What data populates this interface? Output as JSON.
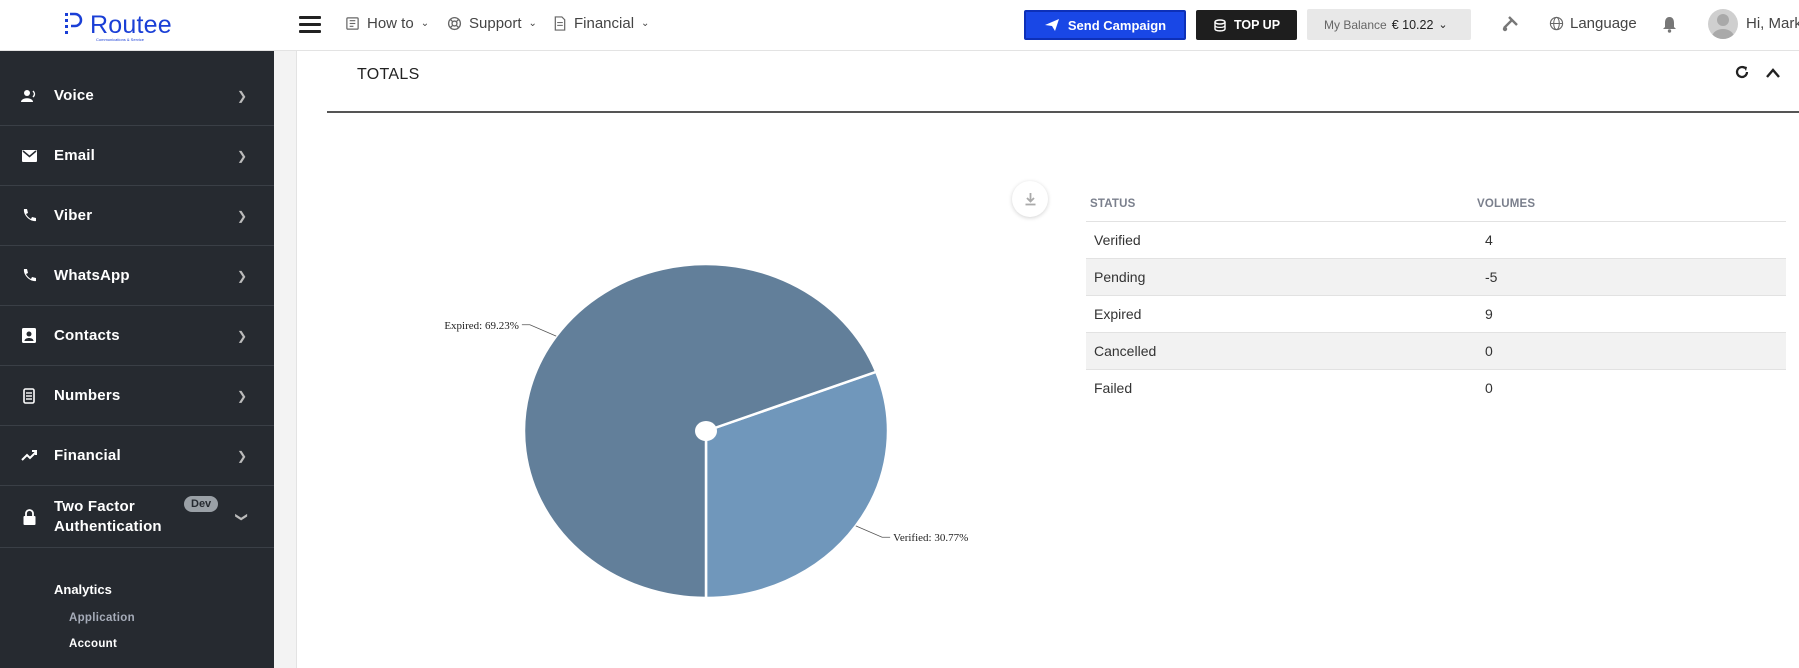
{
  "brand": {
    "name": "Routee",
    "tagline": "Communications & Service"
  },
  "topbar": {
    "nav": [
      {
        "label": "How to",
        "icon": "book-icon"
      },
      {
        "label": "Support",
        "icon": "lifebuoy-icon"
      },
      {
        "label": "Financial",
        "icon": "document-icon"
      }
    ],
    "send_campaign_label": "Send Campaign",
    "top_up_label": "TOP UP",
    "balance_label": "My Balance",
    "balance_value": "€ 10.22",
    "language_label": "Language",
    "greeting": "Hi, Mark"
  },
  "sidebar": {
    "items": [
      {
        "label": "Voice",
        "icon": "voice-icon"
      },
      {
        "label": "Email",
        "icon": "email-icon"
      },
      {
        "label": "Viber",
        "icon": "viber-icon"
      },
      {
        "label": "WhatsApp",
        "icon": "whatsapp-icon"
      },
      {
        "label": "Contacts",
        "icon": "contacts-icon"
      },
      {
        "label": "Numbers",
        "icon": "numbers-icon"
      },
      {
        "label": "Financial",
        "icon": "trending-up-icon"
      }
    ],
    "two_factor": {
      "line1": "Two Factor",
      "line2": "Authentication",
      "badge": "Dev"
    },
    "submenu": {
      "analytics": "Analytics",
      "application": "Application",
      "account": "Account"
    }
  },
  "panel": {
    "title": "TOTALS"
  },
  "table": {
    "headers": [
      "STATUS",
      "VOLUMES"
    ],
    "rows": [
      {
        "status": "Verified",
        "volume": "4"
      },
      {
        "status": "Pending",
        "volume": "-5"
      },
      {
        "status": "Expired",
        "volume": "9"
      },
      {
        "status": "Cancelled",
        "volume": "0"
      },
      {
        "status": "Failed",
        "volume": "0"
      }
    ]
  },
  "colors": {
    "accent": "#1947e6",
    "sidebar_bg": "#262a30",
    "slice_expired": "#627f9a",
    "slice_verified": "#7097bb"
  },
  "chart_data": {
    "type": "pie",
    "slices": [
      {
        "name": "Verified",
        "value": 30.77,
        "label": "Verified: 30.77%"
      },
      {
        "name": "Expired",
        "value": 69.23,
        "label": "Expired: 69.23%"
      }
    ],
    "unit": "%"
  }
}
